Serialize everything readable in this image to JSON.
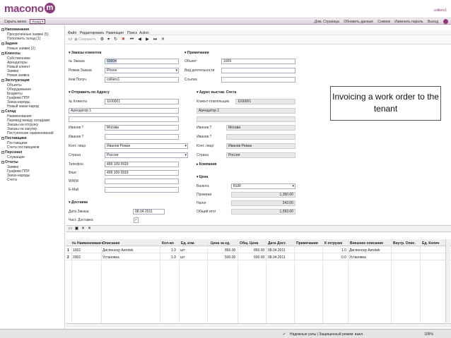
{
  "app": {
    "logo_text": "macono",
    "logo_circle": "m",
    "username": "colliers1",
    "brand_color": "#8c3b7c"
  },
  "nav": {
    "hide_menu": "Скрыть меню",
    "back": "Назад",
    "links": [
      "Дом. Страница",
      "Обновить данные",
      "Снимок",
      "Изменить пароль",
      "Выход"
    ]
  },
  "sidebar": {
    "groups": [
      {
        "title": "Напоминания",
        "items": [
          "Просроченные заявки (5)",
          "Пополнить склад (1)"
        ]
      },
      {
        "title": "Задачи",
        "items": [
          "Новые заявки (2)"
        ]
      },
      {
        "title": "Клиенты",
        "items": [
          "Собственники",
          "Арендаторы",
          "Новый клиент",
          "Заявки",
          "Новая заявка"
        ]
      },
      {
        "title": "Эксплуатация",
        "items": [
          "Объекты",
          "Оборудование",
          "Бюджеты",
          "Графики ППР",
          "Заказ-наряды",
          "Новый заказ-наряд"
        ]
      },
      {
        "title": "Склад",
        "items": [
          "Наименования",
          "Перевод между складами",
          "Заказы на отгрузку",
          "Заказы на закупку",
          "Поступление наименований"
        ]
      },
      {
        "title": "Поставщики",
        "items": [
          "Поставщики",
          "Счета поставщиков"
        ]
      },
      {
        "title": "Персонал",
        "items": [
          "Служащие"
        ]
      },
      {
        "title": "Отчеты",
        "items": [
          "Заявки",
          "Графики ППР",
          "Заказ-наряды",
          "Счета"
        ]
      }
    ]
  },
  "menu": [
    "Файл",
    "Редактировать",
    "Навигация",
    "Поиск",
    "Action"
  ],
  "toolbar": {
    "save_label": "Сохранить"
  },
  "form": {
    "orders": {
      "title": "Заказы клиентов",
      "order_no_label": "№ Заказа",
      "order_no": "60004",
      "mode_label": "Режим Заказа",
      "mode": "Phone",
      "recipient_label": "Кем Получ.",
      "recipient": "colliers1"
    },
    "notes": {
      "title": "Примечания",
      "object_label": "Объект",
      "object": "1005",
      "activity_label": "Вид деятельности",
      "activity": "",
      "link_label": "Ссылка",
      "link": ""
    },
    "ship": {
      "title": "Отправить по Адресу",
      "client_no_label": "№ Клиента",
      "client_no": "1100001",
      "tenant": "Арендатор 1",
      "city_label": "Иванов ?",
      "city": "Москва",
      "city2_label": "Иванов ?",
      "contact_label": "Конт. лицо",
      "contact": "Иванов Роман",
      "country_label": "Страна",
      "country": "Россия",
      "phone_label": "Телефон",
      "phone": "499 109 0919",
      "fax_label": "Факс",
      "fax": "499 109 0919",
      "www_label": "WWW",
      "email_label": "E-Mail"
    },
    "bill": {
      "title": "Адрес выстав. Счета",
      "payer_label": "Клиент-плательщик",
      "payer": "1100001",
      "tenant": "Арендатор 1",
      "city_label": "Иванов ?",
      "city": "Москва",
      "city2_label": "Иванов ?",
      "contact_label": "Конт. лицо",
      "contact": "Иванов Роман",
      "country_label": "Страна",
      "country": "Россия"
    },
    "company": {
      "title": "Компания"
    },
    "price": {
      "title": "Цена",
      "currency_label": "Валюта",
      "currency": "RUR",
      "subtotal_label": "Промежн",
      "subtotal": "1,350.00",
      "tax_label": "Налог",
      "tax": "243.00",
      "total_label": "Общий итог",
      "total": "1,593.00"
    },
    "delivery": {
      "title": "Доставка",
      "date_label": "Дата Заказа",
      "date": "08.04.2011",
      "partial_label": "Част. Доставка"
    }
  },
  "callout": "Invoicing a work order to the tenant",
  "grid": {
    "columns": [
      "№ Наименования",
      "Описание",
      "Кол-во",
      "Ед. изм.",
      "Цена за ед.",
      "Общ. Цена",
      "Дата Дост.",
      "Примечания",
      "К отгрузке",
      "Внешнее описание",
      "Внутр. Опис.",
      "Ед. Колич"
    ],
    "rows": [
      {
        "num": "1",
        "code": "1002",
        "desc": "Диспенсер Aerotek",
        "qty": "1.0",
        "unit": "шт",
        "price": "850.00",
        "total": "850.00",
        "date": "08.04.2011",
        "notes": "",
        "ship": "1.0",
        "ext": "Диспенсер Aerotek"
      },
      {
        "num": "2",
        "code": "2002",
        "desc": "Установка",
        "qty": "1.0",
        "unit": "шт",
        "price": "500.00",
        "total": "500.00",
        "date": "08.04.2011",
        "notes": "",
        "ship": "0.0",
        "ext": "Установка"
      }
    ]
  },
  "status": {
    "secure": "Надежные узлы | Защищенный режим: выкл.",
    "zoom": "105%"
  }
}
